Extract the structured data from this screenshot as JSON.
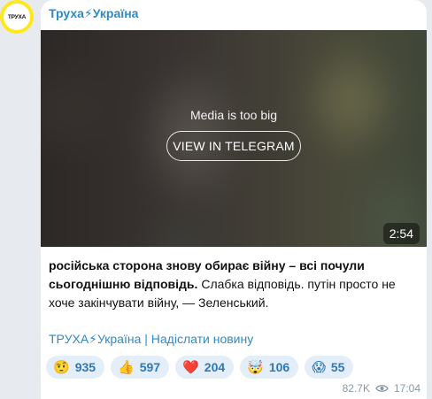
{
  "avatar": {
    "text": "ТРУХА"
  },
  "channel": {
    "name": "Труха⚡Україна"
  },
  "media": {
    "label": "Media is too big",
    "button_label": "VIEW IN TELEGRAM",
    "duration": "2:54"
  },
  "post": {
    "bold_text": "російська сторона знову обирає війну – всі почули сьогоднішню відповідь.",
    "text": " Слабка відповідь. путін просто не хоче закінчувати війну, — Зеленський.",
    "footer_link": "ТРУХА⚡Україна | Надіслати новину"
  },
  "reactions": [
    {
      "emoji": "🤨",
      "count": "935"
    },
    {
      "emoji": "👍",
      "count": "597"
    },
    {
      "emoji": "❤️",
      "count": "204"
    },
    {
      "emoji": "🤯",
      "count": "106"
    },
    {
      "emoji": "😱",
      "count": "55"
    }
  ],
  "meta": {
    "views": "82.7K",
    "time": "17:04"
  },
  "colors": {
    "link": "#2e8ac7",
    "reaction_bg": "#e3eef8",
    "avatar_ring": "#ffe81a"
  }
}
